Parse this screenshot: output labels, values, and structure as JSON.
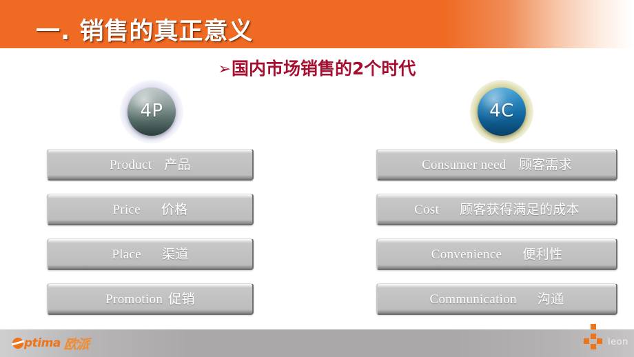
{
  "header": {
    "title": "一. 销售的真正意义",
    "band_color": "#ef6a23"
  },
  "subtitle": {
    "bullet": "➢",
    "text": "国内市场销售的2个时代",
    "color": "#a51030"
  },
  "spheres": [
    {
      "label": "4P",
      "color": "#5e7471",
      "glow": "#cdcde8"
    },
    {
      "label": "4C",
      "color": "#12679f",
      "glow": "#c4c278"
    }
  ],
  "columns": {
    "left": {
      "sphere_label": "4P",
      "items": [
        {
          "en": "Product",
          "cn": "产品"
        },
        {
          "en": "Price",
          "cn": "价格"
        },
        {
          "en": "Place",
          "cn": "渠道"
        },
        {
          "en": "Promotion",
          "cn": "促销"
        }
      ]
    },
    "right": {
      "sphere_label": "4C",
      "items": [
        {
          "en": "Consumer need",
          "cn": "顾客需求"
        },
        {
          "en": "Cost",
          "cn": "顾客获得满足的成本"
        },
        {
          "en": "Convenience",
          "cn": "便利性"
        },
        {
          "en": "Communication",
          "cn": "沟通"
        }
      ]
    }
  },
  "footer": {
    "brand_word": "ptima",
    "brand_cn": "欧派",
    "author": "leon",
    "accent_color": "#ef7317"
  }
}
